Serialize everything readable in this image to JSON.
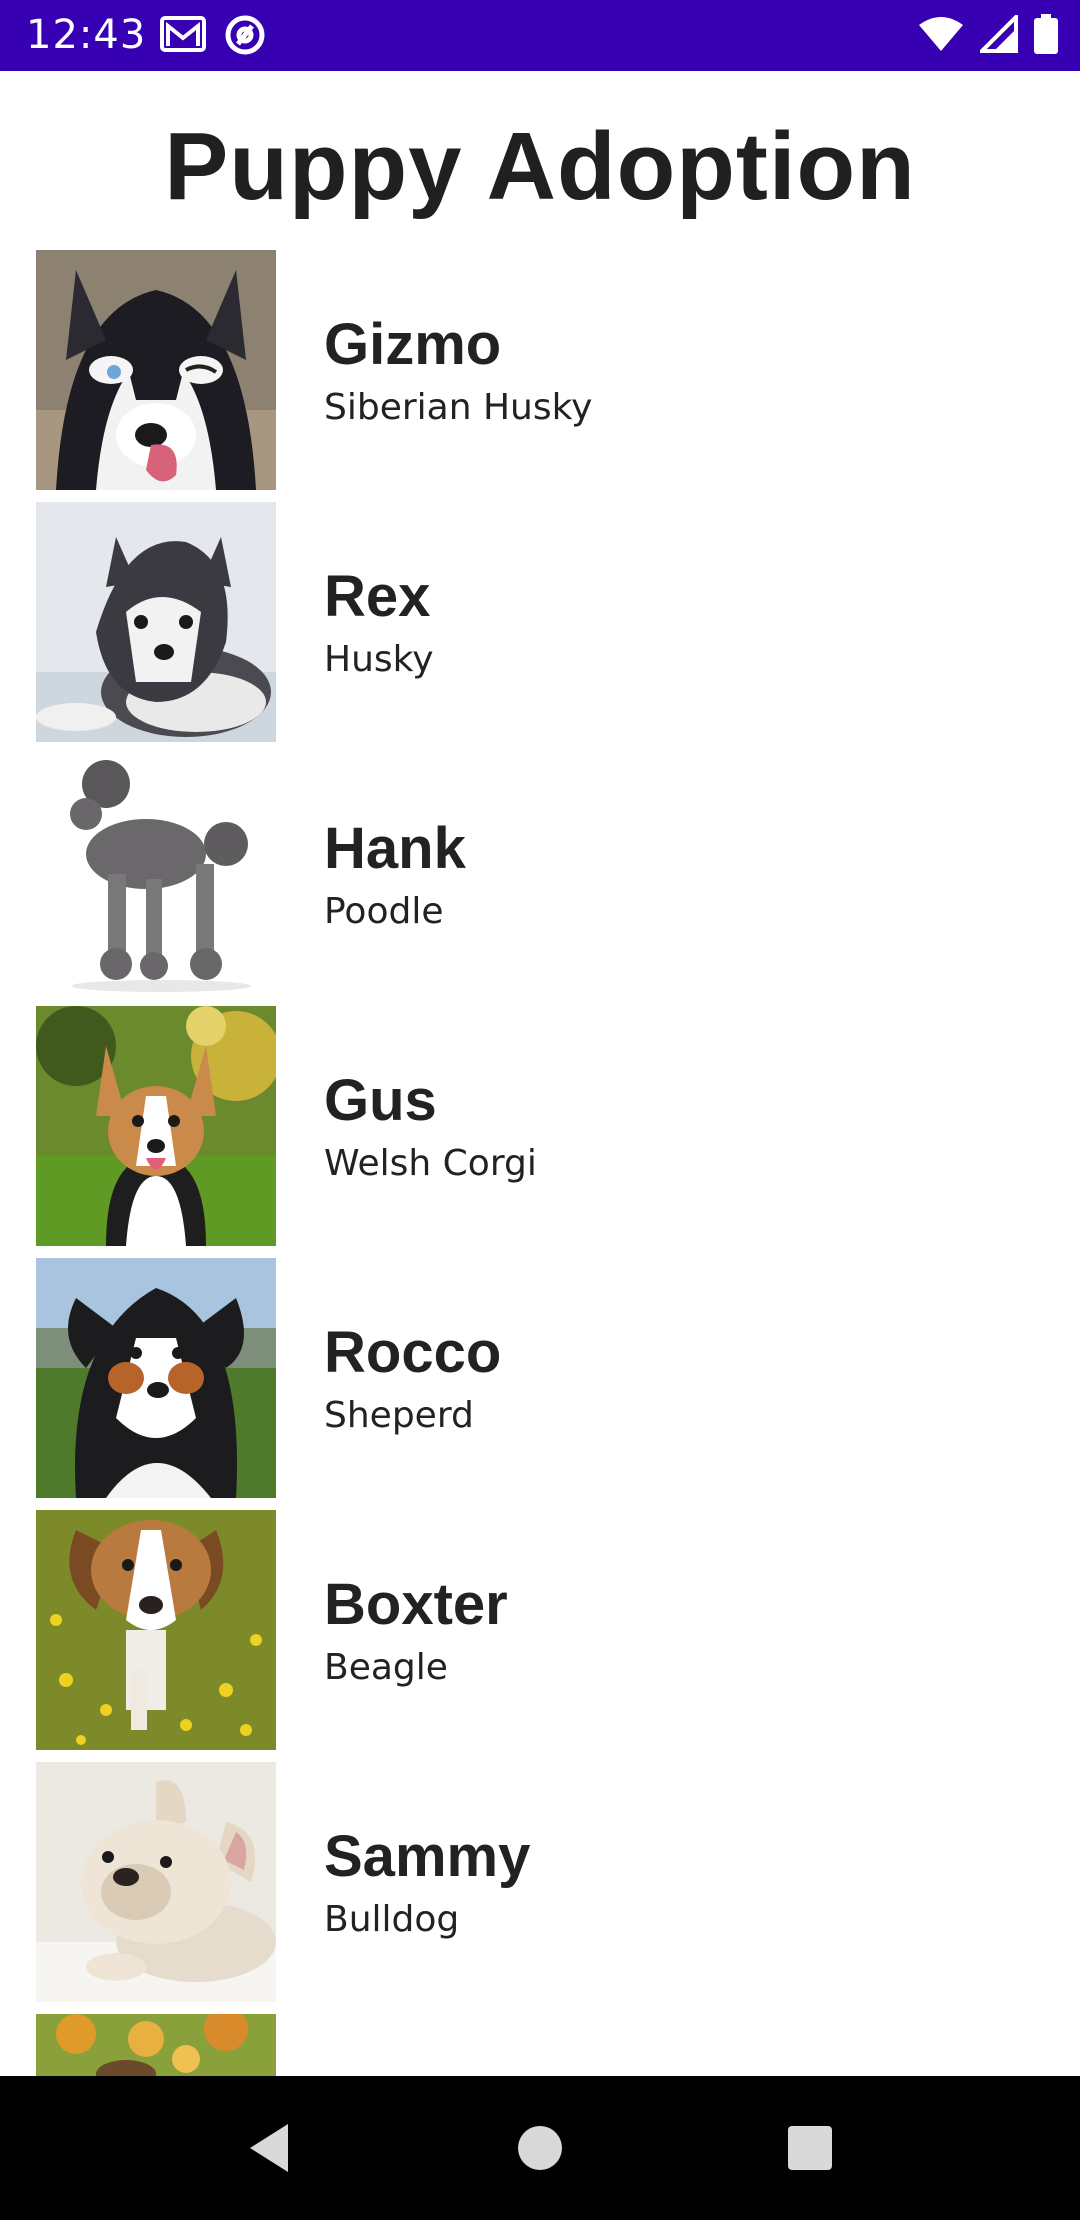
{
  "status_bar": {
    "time": "12:43",
    "background": "#3700b3",
    "left_icons": [
      "gmail-icon",
      "at-sign-icon"
    ],
    "right_icons": [
      "wifi-icon",
      "cellular-signal-icon",
      "battery-icon"
    ]
  },
  "app": {
    "title": "Puppy Adoption"
  },
  "dogs": [
    {
      "name": "Gizmo",
      "breed": "Siberian Husky"
    },
    {
      "name": "Rex",
      "breed": "Husky"
    },
    {
      "name": "Hank",
      "breed": "Poodle"
    },
    {
      "name": "Gus",
      "breed": "Welsh Corgi"
    },
    {
      "name": "Rocco",
      "breed": "Sheperd"
    },
    {
      "name": "Boxter",
      "breed": "Beagle"
    },
    {
      "name": "Sammy",
      "breed": "Bulldog"
    },
    {
      "name": "",
      "breed": ""
    }
  ],
  "nav_bar": {
    "buttons": [
      "back-icon",
      "home-icon",
      "recents-icon"
    ]
  }
}
